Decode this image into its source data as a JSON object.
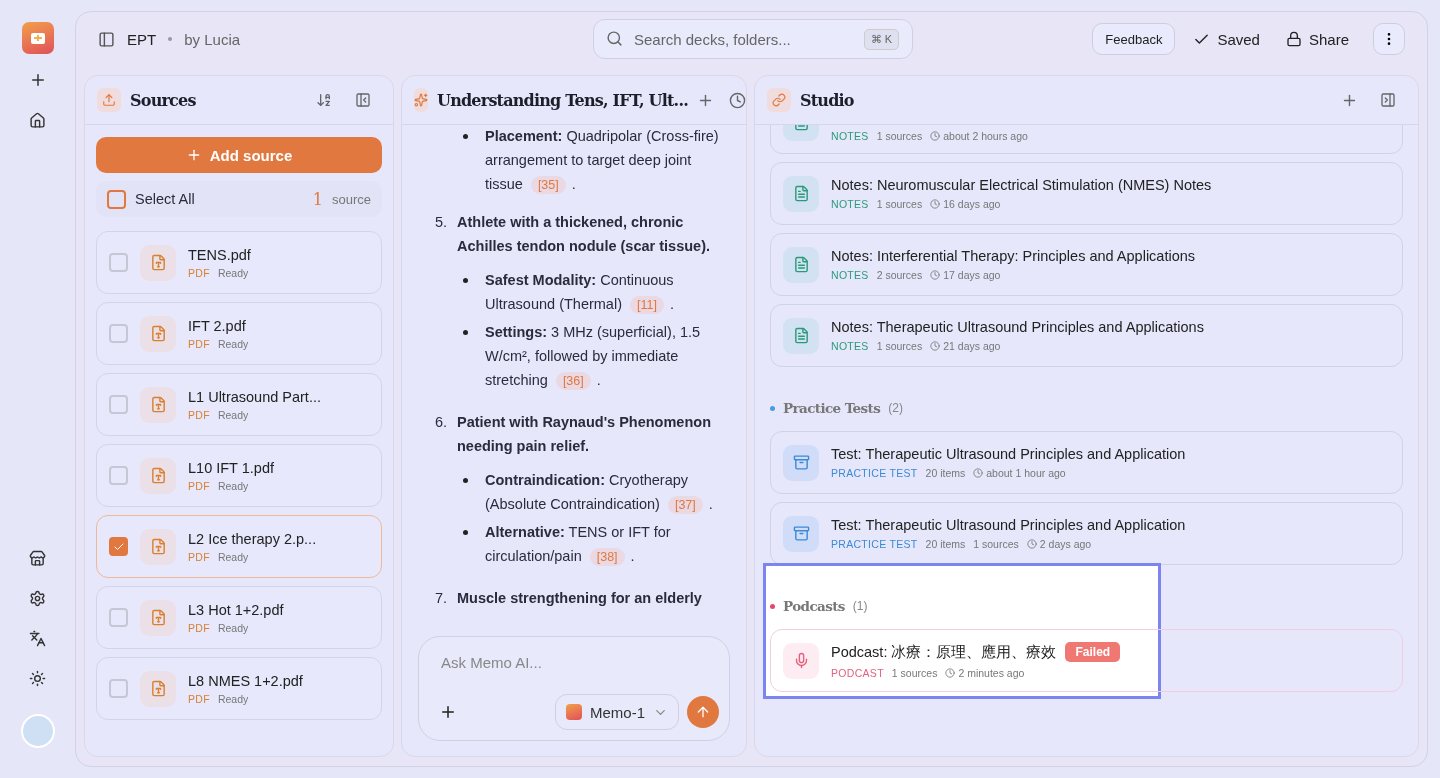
{
  "header": {
    "title": "EPT",
    "author": "by Lucia",
    "search": {
      "placeholder": "Search decks, folders...",
      "shortcut": "⌘ K"
    },
    "feedback": "Feedback",
    "saved": "Saved",
    "share": "Share"
  },
  "sources": {
    "title": "Sources",
    "add_button": "Add source",
    "select_all": {
      "label": "Select All",
      "checked": false
    },
    "count": "1",
    "count_label": "source",
    "items": [
      {
        "name": "TENS.pdf",
        "type": "PDF",
        "status": "Ready",
        "checked": false
      },
      {
        "name": "IFT 2.pdf",
        "type": "PDF",
        "status": "Ready",
        "checked": false
      },
      {
        "name": "L1 Ultrasound Part...",
        "type": "PDF",
        "status": "Ready",
        "checked": false
      },
      {
        "name": "L10 IFT 1.pdf",
        "type": "PDF",
        "status": "Ready",
        "checked": false
      },
      {
        "name": "L2 Ice therapy 2.p...",
        "type": "PDF",
        "status": "Ready",
        "checked": true
      },
      {
        "name": "L3 Hot 1+2.pdf",
        "type": "PDF",
        "status": "Ready",
        "checked": false
      },
      {
        "name": "L8 NMES 1+2.pdf",
        "type": "PDF",
        "status": "Ready",
        "checked": false
      }
    ]
  },
  "chat": {
    "title": "Understanding Tens, IFT, Ult...",
    "items": [
      {
        "bullets": [
          {
            "text": "**Placement:** Quadripolar (Cross-fire) arrangement to target deep joint tissue",
            "cite": "[35]",
            "tail": "."
          }
        ]
      },
      {
        "number": "5.",
        "heading": "Athlete with a thickened, chronic Achilles tendon nodule (scar tissue).",
        "bullets": [
          {
            "text": "**Safest Modality:** Continuous Ultrasound (Thermal)",
            "cite": "[11]",
            "tail": "."
          },
          {
            "text": "**Settings:** 3 MHz (superficial), 1.5 W/cm², followed by immediate stretching",
            "cite": "[36]",
            "tail": "."
          }
        ]
      },
      {
        "number": "6.",
        "heading": "Patient with Raynaud's Phenomenon needing pain relief.",
        "bullets": [
          {
            "text": "**Contraindication:** Cryotherapy (Absolute Contraindication)",
            "cite": "[37]",
            "tail": "."
          },
          {
            "text": "**Alternative:** TENS or IFT for circulation/pain",
            "cite": "[38]",
            "tail": "."
          }
        ]
      },
      {
        "number": "7.",
        "heading": "Muscle strengthening for an elderly"
      }
    ],
    "input": {
      "placeholder": "Ask Memo AI..."
    },
    "model": "Memo-1"
  },
  "studio": {
    "title": "Studio",
    "sections": [
      {
        "items": [
          {
            "kind": "notes",
            "type_label": "NOTES",
            "meta": [
              "1 sources"
            ],
            "time": "about 2 hours ago"
          },
          {
            "kind": "notes",
            "title": "Notes: Neuromuscular Electrical Stimulation (NMES) Notes",
            "type_label": "NOTES",
            "meta": [
              "1 sources"
            ],
            "time": "16 days ago"
          },
          {
            "kind": "notes",
            "title": "Notes: Interferential Therapy: Principles and Applications",
            "type_label": "NOTES",
            "meta": [
              "2 sources"
            ],
            "time": "17 days ago"
          },
          {
            "kind": "notes",
            "title": "Notes: Therapeutic Ultrasound Principles and Applications",
            "type_label": "NOTES",
            "meta": [
              "1 sources"
            ],
            "time": "21 days ago"
          }
        ]
      },
      {
        "title": "Practice Tests",
        "count": "(2)",
        "color": "#4a9be0",
        "items": [
          {
            "kind": "test",
            "title": "Test: Therapeutic Ultrasound Principles and Application",
            "type_label": "PRACTICE TEST",
            "meta": [
              "20 items"
            ],
            "time": "about 1 hour ago"
          },
          {
            "kind": "test",
            "title": "Test: Therapeutic Ultrasound Principles and Application",
            "type_label": "PRACTICE TEST",
            "meta": [
              "20 items",
              "1 sources"
            ],
            "time": "2 days ago"
          }
        ]
      },
      {
        "title": "Podcasts",
        "count": "(1)",
        "color": "#e5486e",
        "highlighted": true,
        "items": [
          {
            "kind": "podcast",
            "title": "Podcast: 冰療：原理、應用、療效",
            "badge": "Failed",
            "type_label": "PODCAST",
            "meta": [
              "1 sources"
            ],
            "time": "2 minutes ago"
          }
        ]
      }
    ]
  }
}
